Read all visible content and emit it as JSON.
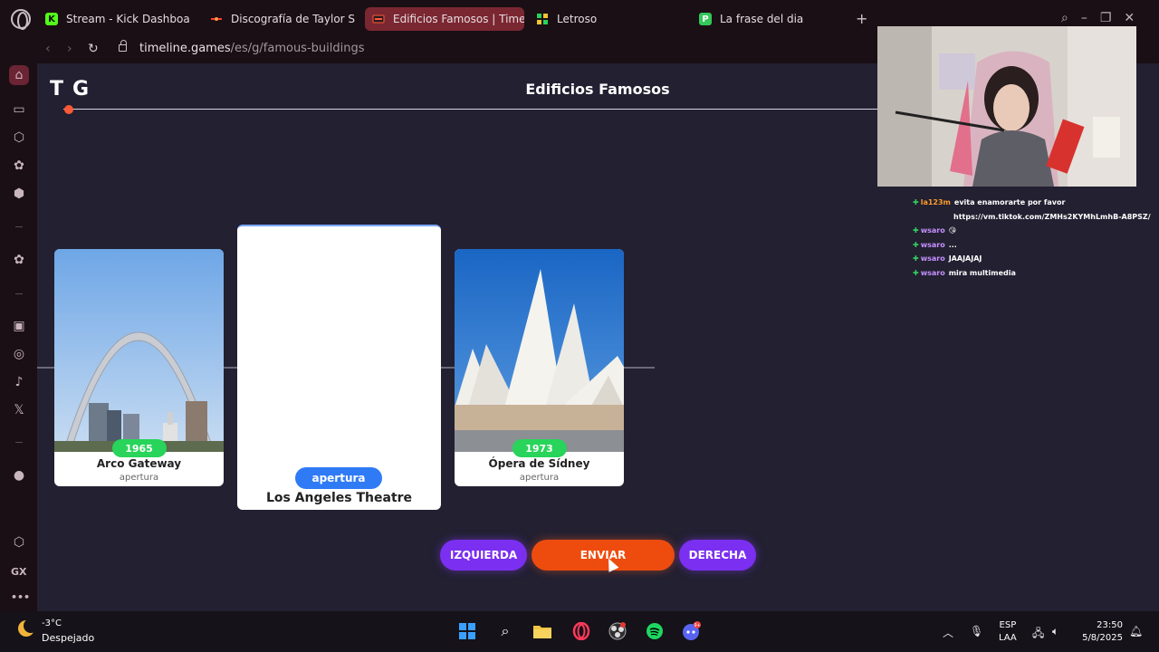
{
  "browser": {
    "tabs": [
      {
        "label": "Stream - Kick Dashboard",
        "favicon": "K",
        "favicon_color": "#53fc18",
        "active": false
      },
      {
        "label": "Discografía de Taylor Sw",
        "favicon": "",
        "favicon_color": "#ff3b3b",
        "active": false
      },
      {
        "label": "Edificios Famosos | Timel",
        "favicon": "",
        "favicon_color": "#ff5a36",
        "active": true
      },
      {
        "label": "Letroso",
        "favicon": "",
        "favicon_color": "#2ad15a",
        "active": false
      },
      {
        "label": "La frase del dia",
        "favicon": "P",
        "favicon_color": "#34c759",
        "active": false
      }
    ],
    "new_tab": "+",
    "url_host": "timeline.games",
    "url_path": "/es/g/famous-buildings"
  },
  "sidebar": {
    "gx_label": "GX",
    "more_label": "•••"
  },
  "game": {
    "logo": "TG",
    "title": "Edificios Famosos",
    "cards": [
      {
        "year": "1965",
        "name": "Arco Gateway",
        "category": "apertura"
      },
      {
        "year": "1973",
        "name": "Ópera de Sídney",
        "category": "apertura"
      }
    ],
    "active_card": {
      "category": "apertura",
      "name": "Los Angeles Theatre"
    },
    "buttons": {
      "left": "IZQUIERDA",
      "submit": "ENVIAR",
      "right": "DERECHA"
    },
    "colors": {
      "accent_orange": "#ee4c0f",
      "accent_purple": "#7b2ff0",
      "year_green": "#28d45a",
      "pill_blue": "#2f7bf5"
    }
  },
  "chat": [
    {
      "user": "la123m",
      "msg": "evita enamorarte por favor",
      "url": "https://vm.tiktok.com/ZMHs2KYMhLmhB-A8PSZ/"
    },
    {
      "user": "wsaro",
      "msg": "😘"
    },
    {
      "user": "wsaro",
      "msg": "..."
    },
    {
      "user": "wsaro",
      "msg": "JAAJAJAJ"
    },
    {
      "user": "wsaro",
      "msg": "mira multimedia"
    }
  ],
  "taskbar": {
    "temperature": "-3°C",
    "weather": "Despejado",
    "lang_line1": "ESP",
    "lang_line2": "LAA",
    "time": "23:50",
    "date": "5/8/2025",
    "discord_badge": "9+"
  }
}
